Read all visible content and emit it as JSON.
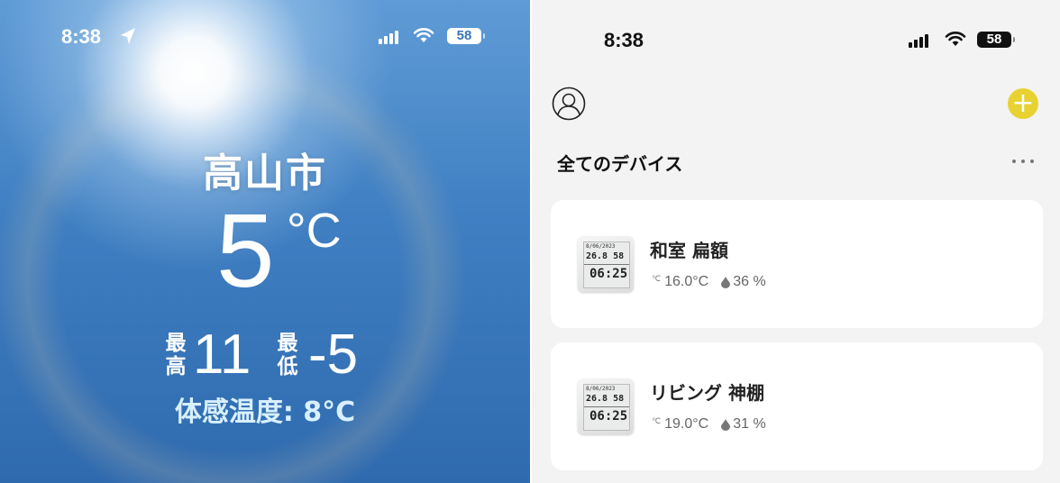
{
  "weather": {
    "status": {
      "time": "8:38",
      "battery": "58"
    },
    "city": "高山市",
    "temperature": "5",
    "temperature_unit": "°C",
    "high_label": "最高",
    "high_value": "11",
    "low_label": "最低",
    "low_value": "-5",
    "feels_like": "体感温度: 8°C"
  },
  "devices_app": {
    "status": {
      "time": "8:38",
      "battery": "58"
    },
    "section_title": "全てのデバイス",
    "add_icon": "plus-icon",
    "profile_icon": "user-icon",
    "more_icon": "ellipsis-icon",
    "accent_color": "#e8d232",
    "devices": [
      {
        "name": "和室 扁額",
        "temperature": "16.0°C",
        "humidity": "36 %",
        "thumb": {
          "date": "8/06/2023",
          "temp": "26.8",
          "hum": "58",
          "clock": "06:25"
        }
      },
      {
        "name": "リビング 神棚",
        "temperature": "19.0°C",
        "humidity": "31 %",
        "thumb": {
          "date": "8/06/2023",
          "temp": "26.8",
          "hum": "58",
          "clock": "06:25"
        }
      }
    ]
  }
}
